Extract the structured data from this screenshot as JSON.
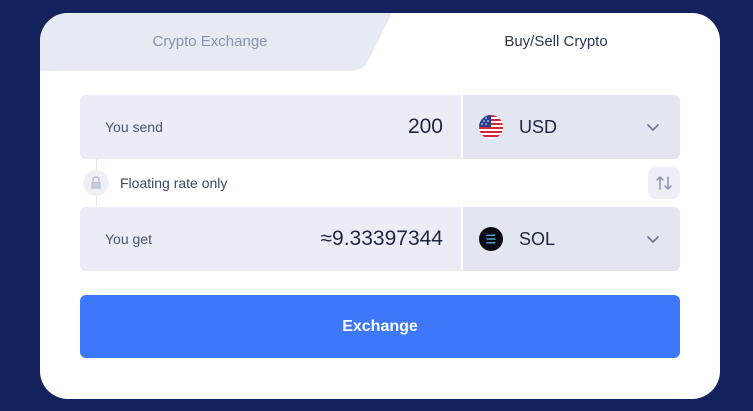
{
  "tabs": {
    "crypto_exchange": "Crypto Exchange",
    "buy_sell": "Buy/Sell Crypto"
  },
  "send": {
    "label": "You send",
    "amount": "200",
    "currency": "USD",
    "icon": "us-flag-icon"
  },
  "rate": {
    "text": "Floating rate only"
  },
  "get": {
    "label": "You get",
    "amount": "≈9.33397344",
    "currency": "SOL",
    "icon": "solana-icon"
  },
  "button": {
    "label": "Exchange"
  },
  "colors": {
    "background": "#14235e",
    "accent": "#3d78fb"
  }
}
